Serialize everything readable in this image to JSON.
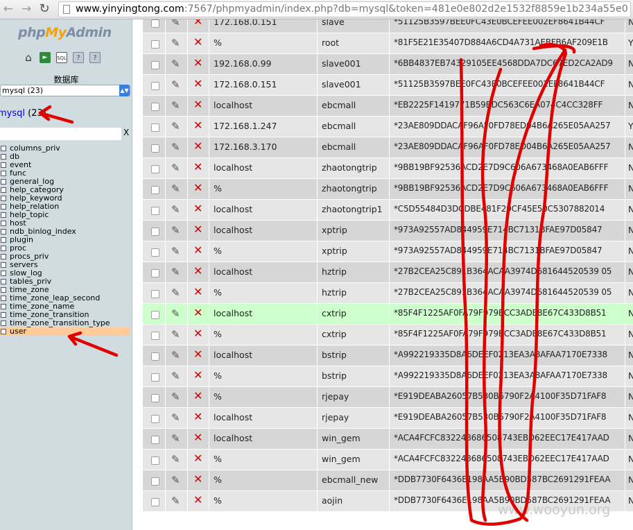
{
  "browser": {
    "url_host": "www.yinyingtong.com",
    "url_rest": ":7567/phpmyadmin/index.php?db=mysql&token=481e0e802d2e1532f8859e1b234a55e0"
  },
  "sidebar": {
    "logo_php": "php",
    "logo_my": "My",
    "logo_admin": "Admin",
    "db_label": "数据库",
    "db_select_value": "mysql (23)",
    "db_link": "mysql",
    "db_link_count": " (23)",
    "filter_clear": "X",
    "tables": [
      "columns_priv",
      "db",
      "event",
      "func",
      "general_log",
      "help_category",
      "help_keyword",
      "help_relation",
      "help_topic",
      "host",
      "ndb_binlog_index",
      "plugin",
      "proc",
      "procs_priv",
      "servers",
      "slow_log",
      "tables_priv",
      "time_zone",
      "time_zone_leap_second",
      "time_zone_name",
      "time_zone_transition",
      "time_zone_transition_type",
      "user"
    ],
    "active_table": "user"
  },
  "rows": [
    {
      "host": "172.168.0.151",
      "user": "slave",
      "password": "*51125B3597BEE0FC43E0BCEFEE002EF8641B44CF",
      "extra": "N"
    },
    {
      "host": "%",
      "user": "root",
      "password": "*81F5E21E35407D884A6CD4A731AEBFB6AF209E1B",
      "extra": "Y"
    },
    {
      "host": "192.168.0.99",
      "user": "slave001",
      "password": "*6BB4837EB74329105EE4568DDA7DC67ED2CA2AD9",
      "extra": "N"
    },
    {
      "host": "172.168.0.151",
      "user": "slave001",
      "password": "*51125B3597BEE0FC43E0BCEFEE002EF8641B44CF",
      "extra": "N"
    },
    {
      "host": "localhost",
      "user": "ebcmall",
      "password": "*EB2225F1419771B59BDC563C6EA074C4CC328FF",
      "extra": "N"
    },
    {
      "host": "172.168.1.247",
      "user": "ebcmall",
      "password": "*23AE809DDACAF96AF0FD78ED04B6A265E05AA257",
      "extra": "Y"
    },
    {
      "host": "172.168.3.170",
      "user": "ebcmall",
      "password": "*23AE809DDACAF96AF0FD78ED04B6A265E05AA257",
      "extra": "N"
    },
    {
      "host": "localhost",
      "user": "zhaotongtrip",
      "password": "*9BB19BF92536ACD2E7D9C606A673468A0EAB6FFF",
      "extra": "N"
    },
    {
      "host": "%",
      "user": "zhaotongtrip",
      "password": "*9BB19BF92536ACD2E7D9C606A673468A0EAB6FFF",
      "extra": "N"
    },
    {
      "host": "localhost",
      "user": "zhaotongtrip1",
      "password": "*C5D55484D3DCDBE481F29CF45E50C5307882014",
      "extra": "N"
    },
    {
      "host": "localhost",
      "user": "xptrip",
      "password": "*973A92557AD844959E714BC7131BFAE97D05847",
      "extra": "N"
    },
    {
      "host": "%",
      "user": "xptrip",
      "password": "*973A92557AD844959E714BC7131BFAE97D05847",
      "extra": "N"
    },
    {
      "host": "localhost",
      "user": "hztrip",
      "password": "*27B2CEA25C891B364ACAA3974D681644520539 05",
      "extra": "N"
    },
    {
      "host": "%",
      "user": "hztrip",
      "password": "*27B2CEA25C891B364ACAA3974D681644520539 05",
      "extra": "N"
    },
    {
      "host": "localhost",
      "user": "cxtrip",
      "password": "*85F4F1225AF0FA79F979BCC3ADE8E67C433D8B51",
      "extra": "N"
    },
    {
      "host": "%",
      "user": "cxtrip",
      "password": "*85F4F1225AF0FA79F979BCC3ADE8E67C433D8B51",
      "extra": "N"
    },
    {
      "host": "localhost",
      "user": "bstrip",
      "password": "*A992219335D8A6DEEF0213EA3A8AFAA7170E7338",
      "extra": "N"
    },
    {
      "host": "%",
      "user": "bstrip",
      "password": "*A992219335D8A6DEEF0213EA3A8AFAA7170E7338",
      "extra": "N"
    },
    {
      "host": "%",
      "user": "rjepay",
      "password": "*E919DEABA26057B530B5790F2A4100F35D71FAF8",
      "extra": "N"
    },
    {
      "host": "localhost",
      "user": "rjepay",
      "password": "*E919DEABA26057B530B5790F2A4100F35D71FAF8",
      "extra": "N"
    },
    {
      "host": "localhost",
      "user": "win_gem",
      "password": "*ACA4FCFC832248686508743EBD62EEC17E417AAD",
      "extra": "N"
    },
    {
      "host": "%",
      "user": "win_gem",
      "password": "*ACA4FCFC832248686508743EBD62EEC17E417AAD",
      "extra": "N"
    },
    {
      "host": "%",
      "user": "ebcmall_new",
      "password": "*DDB7730F6436E198AA5B90BD587BC2691291FEAA",
      "extra": "N"
    },
    {
      "host": "%",
      "user": "aojin",
      "password": "*DDB7730F6436E198AA5B90BD587BC2691291FEAA",
      "extra": "N"
    }
  ],
  "highlight_row": 14,
  "watermark": "www.wooyun.org",
  "colors": {
    "annotation_red": "#e00000",
    "highlight_green": "#ccffcc",
    "active_table_bg": "#ffcc99"
  }
}
